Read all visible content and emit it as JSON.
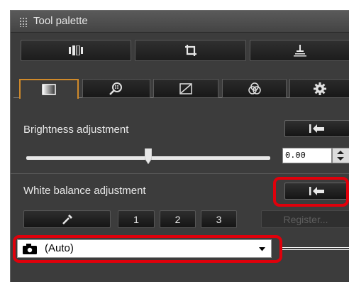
{
  "palette": {
    "title": "Tool palette"
  },
  "top_buttons": [
    {
      "icon": "compare-icon"
    },
    {
      "icon": "crop-icon"
    },
    {
      "icon": "stamp-icon"
    }
  ],
  "tabs": [
    {
      "icon": "basic-adjust-icon",
      "active": true
    },
    {
      "icon": "magnify-icon",
      "active": false
    },
    {
      "icon": "tone-curve-icon",
      "active": false
    },
    {
      "icon": "color-adjust-icon",
      "active": false
    },
    {
      "icon": "settings-gear-icon",
      "active": false
    }
  ],
  "brightness": {
    "label": "Brightness adjustment",
    "value": "0.00",
    "level": 0.5
  },
  "white_balance": {
    "label": "White balance adjustment",
    "eyedropper_icon": "eyedropper-icon",
    "presets": [
      "1",
      "2",
      "3"
    ],
    "register_label": "Register...",
    "selected": "(Auto)",
    "selected_icon": "camera-icon"
  },
  "highlight_color": "#e0000b",
  "accent_color": "#d08a2a"
}
